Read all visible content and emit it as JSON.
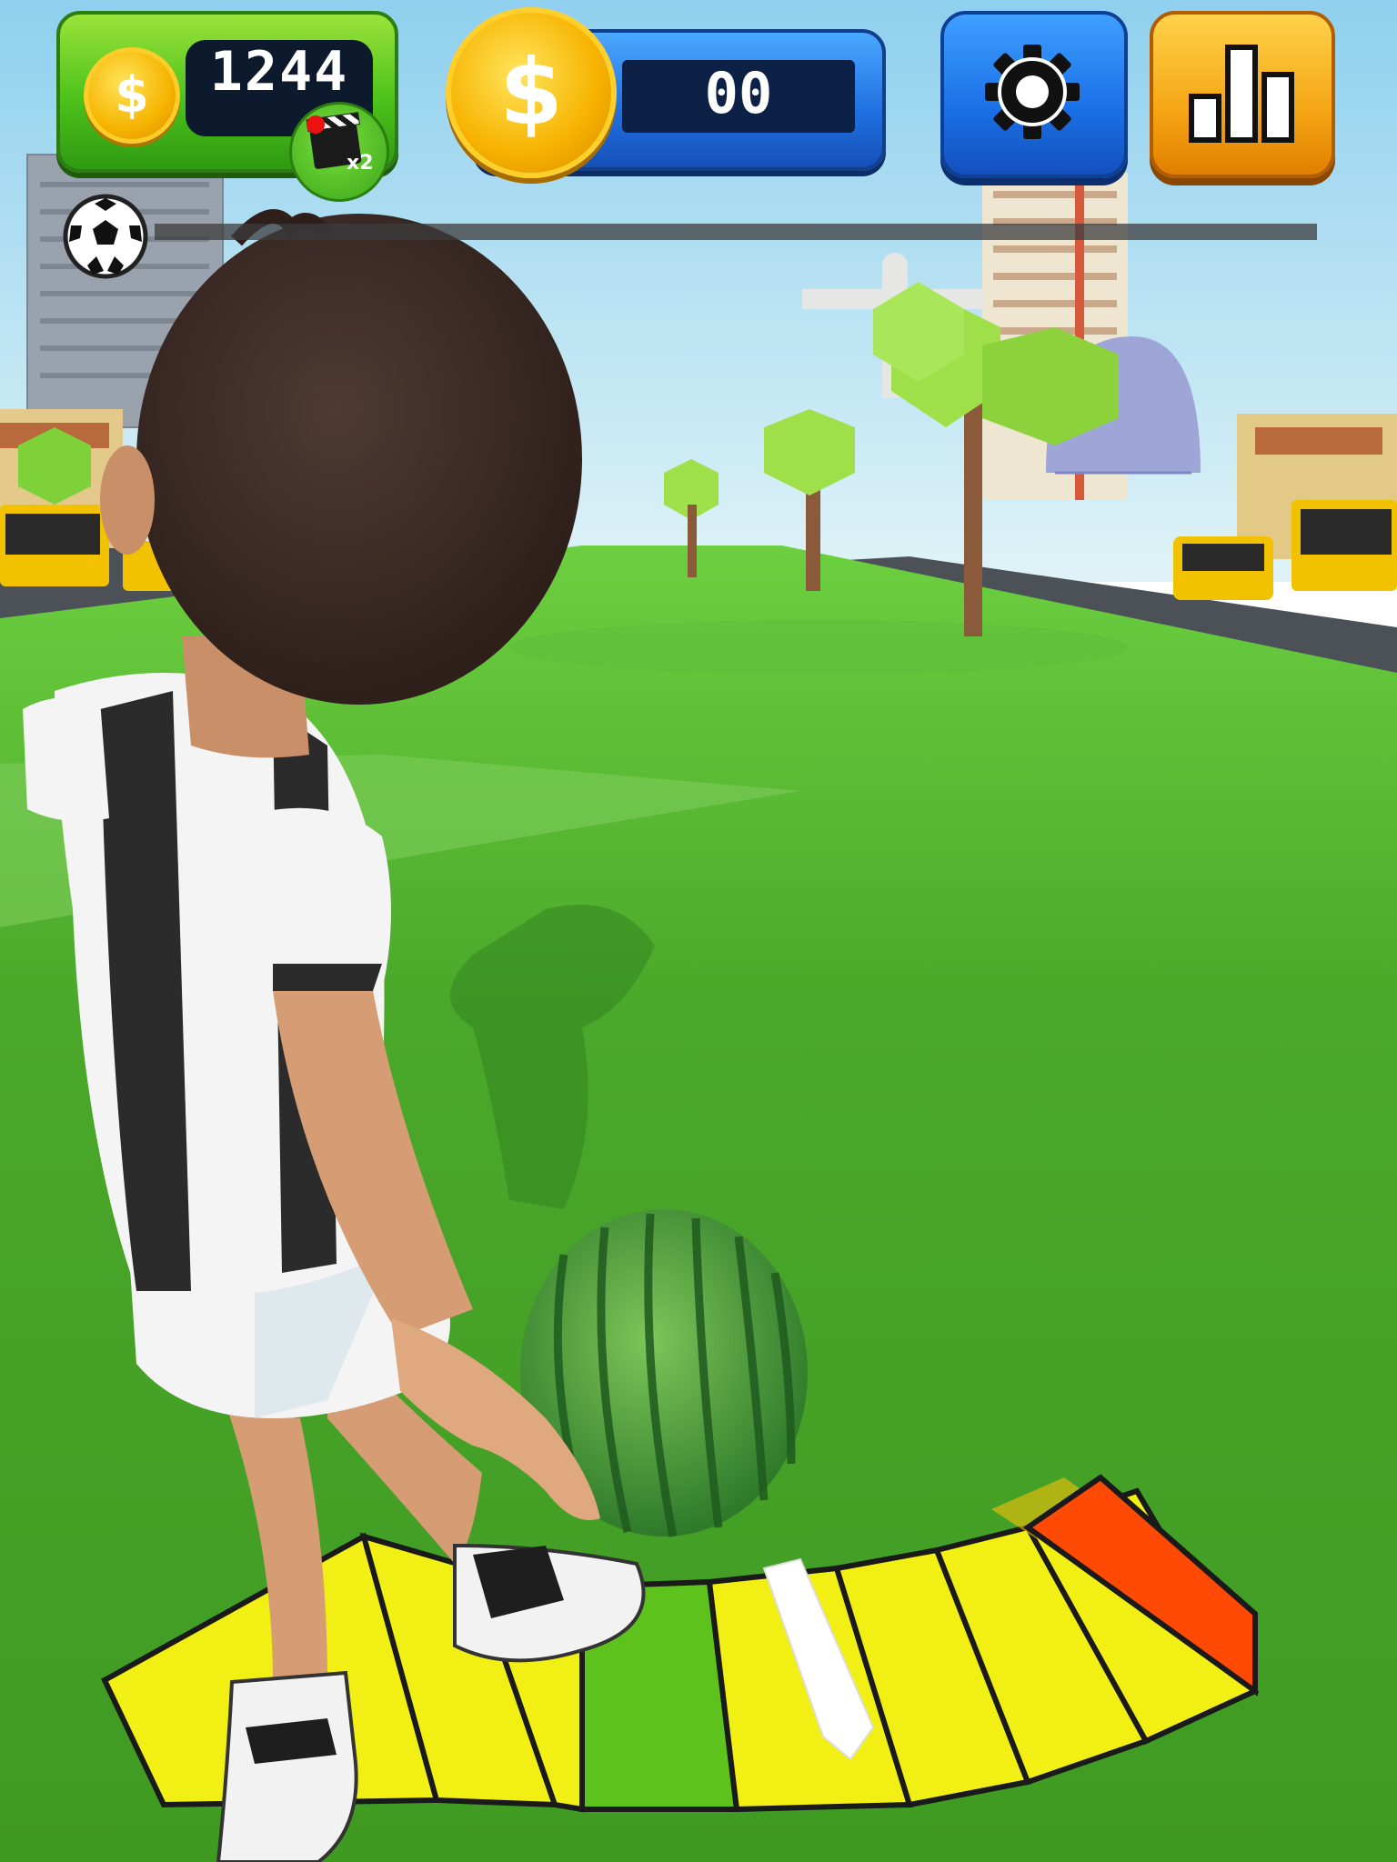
{
  "hud": {
    "wallet": {
      "coin_symbol": "$",
      "coins": "1244",
      "video_bonus": "x2",
      "icon": "video-clapper-icon"
    },
    "score": {
      "coin_symbol": "$",
      "value": "00"
    },
    "settings": {
      "icon": "gear-icon"
    },
    "leaderboard": {
      "icon": "bar-chart-icon"
    },
    "kick_progress": {
      "icon": "soccer-ball-icon",
      "fraction": 0.0
    }
  },
  "scene": {
    "ball": "watermelon",
    "power_meter": {
      "segments": [
        "yellow",
        "yellow",
        "yellow",
        "yellow",
        "green",
        "yellow",
        "yellow",
        "yellow",
        "yellow",
        "red"
      ],
      "indicator_segment": 5
    }
  },
  "colors": {
    "grass": "#4aa82a",
    "sky": "#bfe6f2",
    "meter_yellow": "#f2ef14",
    "meter_green": "#5ec21d",
    "meter_red": "#ff4a05",
    "wallet_green": "#4cc21a",
    "button_blue": "#1f6fe0",
    "button_orange": "#f5a614"
  }
}
